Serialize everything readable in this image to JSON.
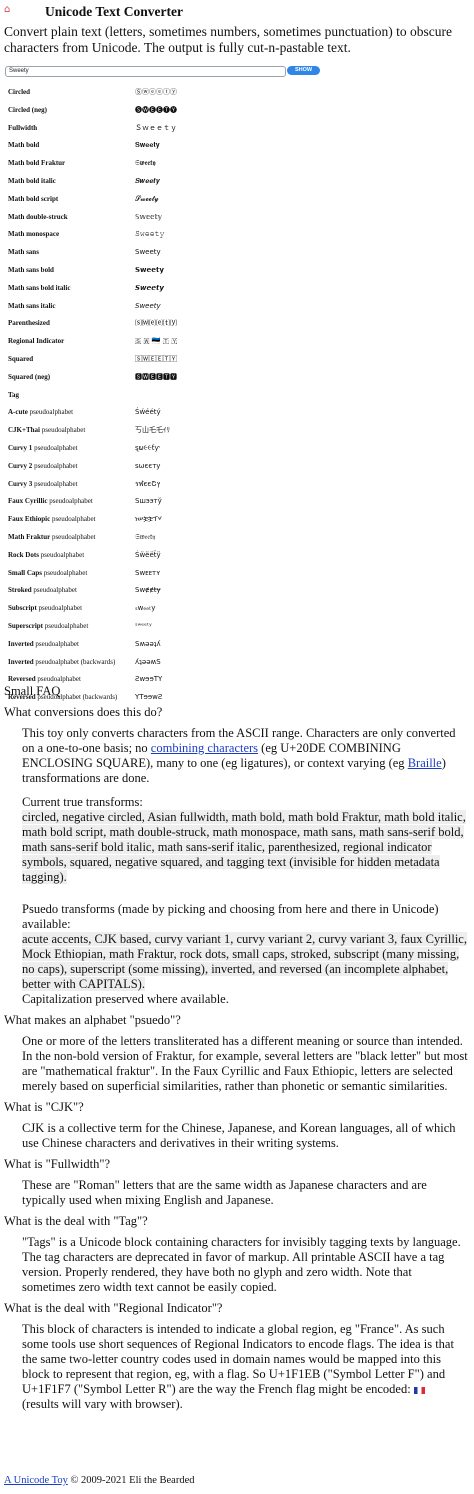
{
  "header": {
    "title": "Unicode Text Converter",
    "intro": "Convert plain text (letters, sometimes numbers, sometimes punctuation) to obscure characters from Unicode. The output is fully cut-n-pastable text."
  },
  "input": {
    "value": "Sweety",
    "show_label": "SHOW"
  },
  "rows": [
    {
      "label": "Circled",
      "suffix": "",
      "output": "Ⓢⓦⓔⓔⓣⓨ"
    },
    {
      "label": "Circled (neg)",
      "suffix": "",
      "output": "🅢🅦🅔🅔🅣🅨"
    },
    {
      "label": "Fullwidth",
      "suffix": "",
      "output": "Ｓｗｅｅｔｙ"
    },
    {
      "label": "Math bold",
      "suffix": "",
      "output": "𝐒𝐰𝐞𝐞𝐭𝐲"
    },
    {
      "label": "Math bold Fraktur",
      "suffix": "",
      "output": "𝕾𝖜𝖊𝖊𝖙𝖞"
    },
    {
      "label": "Math bold italic",
      "suffix": "",
      "output": "𝑺𝒘𝒆𝒆𝒕𝒚"
    },
    {
      "label": "Math bold script",
      "suffix": "",
      "output": "𝓢𝔀𝓮𝓮𝓽𝔂"
    },
    {
      "label": "Math double-struck",
      "suffix": "",
      "output": "𝕊𝕨𝕖𝕖𝕥𝕪"
    },
    {
      "label": "Math monospace",
      "suffix": "",
      "output": "𝚂𝚠𝚎𝚎𝚝𝚢"
    },
    {
      "label": "Math sans",
      "suffix": "",
      "output": "𝖲𝗐𝖾𝖾𝗍𝗒"
    },
    {
      "label": "Math sans bold",
      "suffix": "",
      "output": "𝗦𝘄𝗲𝗲𝘁𝘆"
    },
    {
      "label": "Math sans bold italic",
      "suffix": "",
      "output": "𝙎𝙬𝙚𝙚𝙩𝙮"
    },
    {
      "label": "Math sans italic",
      "suffix": "",
      "output": "𝘚𝘸𝘦𝘦𝘵𝘺"
    },
    {
      "label": "Parenthesized",
      "suffix": "",
      "output": "⒮⒲⒠⒠⒯⒴"
    },
    {
      "label": "Regional Indicator",
      "suffix": "",
      "output": "🇸 🇼 🇪🇪 🇹 🇾"
    },
    {
      "label": "Squared",
      "suffix": "",
      "output": "🅂🅆🄴🄴🅃🅈"
    },
    {
      "label": "Squared (neg)",
      "suffix": "",
      "output": "🆂🆆🅴🅴🆃🆈"
    },
    {
      "label": "Tag",
      "suffix": "",
      "output": ""
    },
    {
      "label": "A-cute",
      "suffix": "pseudoalphabet",
      "output": "Śẃéétý"
    },
    {
      "label": "CJK+Thai",
      "suffix": "pseudoalphabet",
      "output": "丂山乇乇ｲﾘ"
    },
    {
      "label": "Curvy 1",
      "suffix": "pseudoalphabet",
      "output": "ȿພ૯૯ƭƴ"
    },
    {
      "label": "Curvy 2",
      "suffix": "pseudoalphabet",
      "output": "ѕωєєту"
    },
    {
      "label": "Curvy 3",
      "suffix": "pseudoalphabet",
      "output": "รฬєєՇץ"
    },
    {
      "label": "Faux Cyrillic",
      "suffix": "pseudoalphabet",
      "output": "Ѕшээтў"
    },
    {
      "label": "Faux Ethiopic",
      "suffix": "pseudoalphabet",
      "output": "ነሠቿቿፕሃ"
    },
    {
      "label": "Math Fraktur",
      "suffix": "pseudoalphabet",
      "output": "𝔖𝔴𝔢𝔢𝔱𝔶"
    },
    {
      "label": "Rock Dots",
      "suffix": "pseudoalphabet",
      "output": "Ṡẅëëẗÿ"
    },
    {
      "label": "Small Caps",
      "suffix": "pseudoalphabet",
      "output": "Sᴡᴇᴇᴛʏ"
    },
    {
      "label": "Stroked",
      "suffix": "pseudoalphabet",
      "output": "Swɇɇŧɏ"
    },
    {
      "label": "Subscript",
      "suffix": "pseudoalphabet",
      "output": "ₛwₑₑₜy"
    },
    {
      "label": "Superscript",
      "suffix": "pseudoalphabet",
      "output": "ˢʷᵉᵉᵗʸ"
    },
    {
      "label": "Inverted",
      "suffix": "pseudoalphabet",
      "output": "Sʍǝǝʇʎ"
    },
    {
      "label": "Inverted",
      "suffix": "pseudoalphabet (backwards)",
      "output": "ʎʇǝǝʍS"
    },
    {
      "label": "Reversed",
      "suffix": "pseudoalphabet",
      "output": "ƧwɘɘTY"
    },
    {
      "label": "Reversed",
      "suffix": "pseudoalphabet (backwards)",
      "output": "YTɘɘwƧ"
    }
  ],
  "faq": {
    "heading": "Small FAQ",
    "q1": "What conversions does this do?",
    "a1_p1_a": "This toy only converts characters from the ASCII range. Characters are only converted on a one-to-one basis; no ",
    "a1_link1": "combining characters",
    "a1_p1_b": " (eg U+20DE COMBINING ENCLOSING SQUARE), many to one (eg ligatures), or context varying (eg ",
    "a1_link2": "Braille",
    "a1_p1_c": ") transformations are done.",
    "a1_current_label": "Current true transforms:",
    "a1_current": "circled, negative circled, Asian fullwidth, math bold, math bold Fraktur, math bold italic, math bold script, math double-struck, math monospace, math sans, math sans-serif bold, math sans-serif bold italic, math sans-serif italic, parenthesized, regional indicator symbols, squared, negative squared, and tagging text (invisible for hidden metadata tagging).",
    "a1_pseudo_label": "Psuedo transforms (made by picking and choosing from here and there in Unicode) available:",
    "a1_pseudo": "acute accents, CJK based, curvy variant 1, curvy variant 2, curvy variant 3, faux Cyrillic, Mock Ethiopian, math Fraktur, rock dots, small caps, stroked, subscript (many missing, no caps), superscript (some missing), inverted, and reversed (an incomplete alphabet, better with CAPITALS).",
    "a1_caps": "Capitalization preserved where available.",
    "q2": "What makes an alphabet \"psuedo\"?",
    "a2": "One or more of the letters transliterated has a different meaning or source than intended. In the non-bold version of Fraktur, for example, several letters are \"black letter\" but most are \"mathematical fraktur\". In the Faux Cyrillic and Faux Ethiopic, letters are selected merely based on superficial similarities, rather than phonetic or semantic similarities.",
    "q3": "What is \"CJK\"?",
    "a3": "CJK is a collective term for the Chinese, Japanese, and Korean languages, all of which use Chinese characters and derivatives in their writing systems.",
    "q4": "What is \"Fullwidth\"?",
    "a4": "These are \"Roman\" letters that are the same width as Japanese characters and are typically used when mixing English and Japanese.",
    "q5": "What is the deal with \"Tag\"?",
    "a5": "\"Tags\" is a Unicode block containing characters for invisibly tagging texts by language. The tag characters are deprecated in favor of markup. All printable ASCII have a tag version. Properly rendered, they have both no glyph and zero width. Note that sometimes zero width text cannot be easily copied.",
    "q6": "What is the deal with \"Regional Indicator\"?",
    "a6_a": "This block of characters is intended to indicate a global region, eg \"France\". As such some tools use short sequences of Regional Indicators to encode flags. The idea is that the same two-letter country codes used in domain names would be mapped into this block to represent that region, eg, with a flag. So U+1F1EB (\"Symbol Letter F\") and U+1F1F7 (\"Symbol Letter R\") are the way the French flag might be encoded: ",
    "a6_b": "(results will vary with browser)."
  },
  "footer": {
    "link": "A Unicode Toy",
    "text": " © 2009-2021 Eli the Bearded"
  }
}
